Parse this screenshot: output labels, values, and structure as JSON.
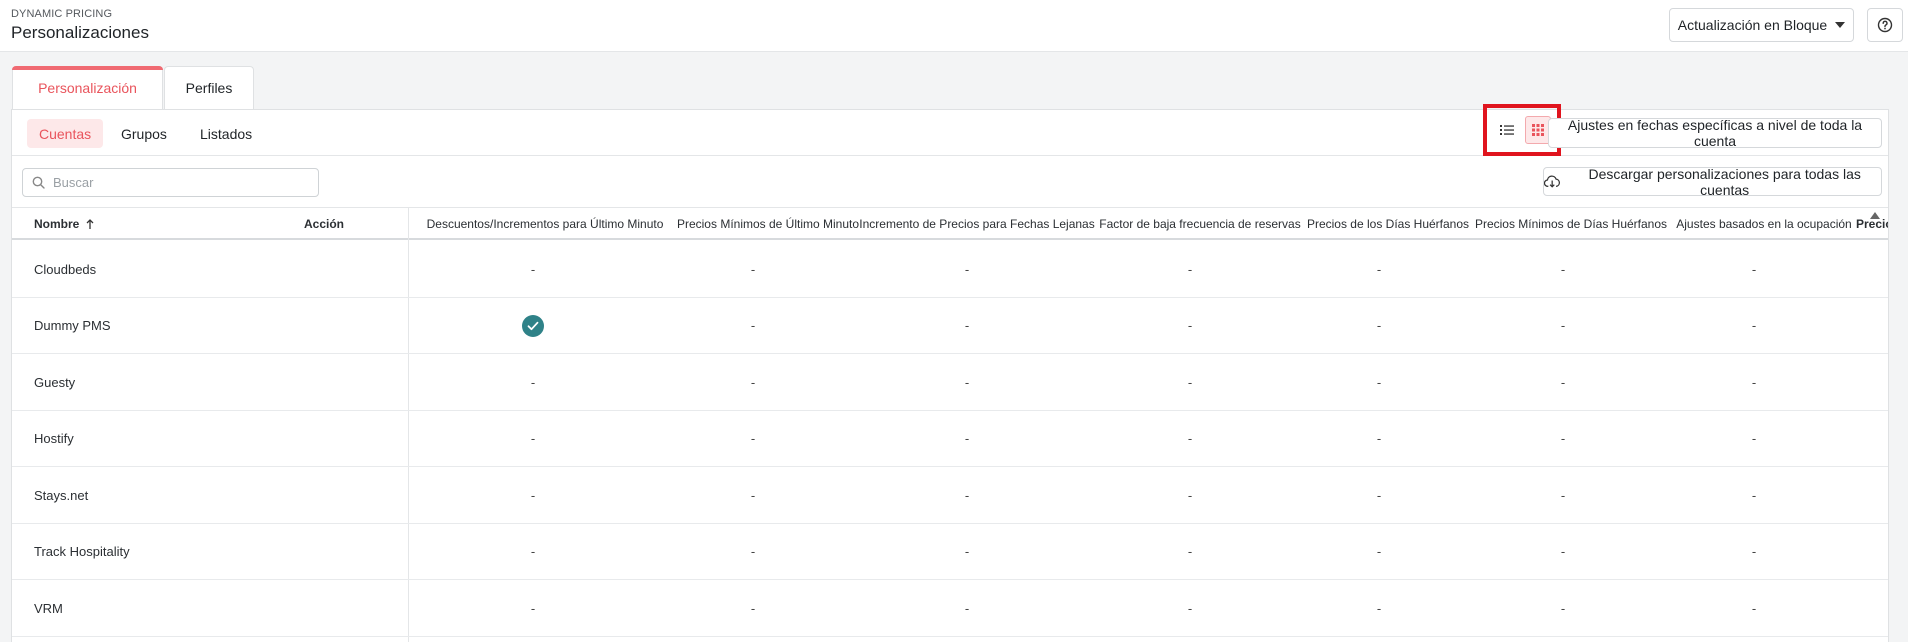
{
  "header": {
    "breadcrumb": "DYNAMIC PRICING",
    "title": "Personalizaciones",
    "bulk_update_label": "Actualización en Bloque"
  },
  "tabs": [
    {
      "label": "Personalización",
      "active": true
    },
    {
      "label": "Perfiles",
      "active": false
    }
  ],
  "subtabs": [
    {
      "label": "Cuentas",
      "active": true
    },
    {
      "label": "Grupos",
      "active": false
    },
    {
      "label": "Listados",
      "active": false
    }
  ],
  "toolbar": {
    "adjust_label": "Ajustes en fechas específicas a nivel de toda la cuenta",
    "download_label": "Descargar personalizaciones para todas las cuentas",
    "search_placeholder": "Buscar"
  },
  "table": {
    "name_header": "Nombre",
    "action_header": "Acción",
    "columns": [
      "Descuentos/Incrementos para Último Minuto",
      "Precios Mínimos de Último Minuto",
      "Incremento de Precios para Fechas Lejanas",
      "Factor de baja frecuencia de reservas",
      "Precios de los Días Huérfanos",
      "Precios Mínimos de Días Huérfanos",
      "Ajustes basados en la ocupación",
      "Precio"
    ],
    "rows": [
      {
        "name": "Cloudbeds",
        "values": [
          "-",
          "-",
          "-",
          "-",
          "-",
          "-",
          "-"
        ]
      },
      {
        "name": "Dummy PMS",
        "values": [
          "check",
          "-",
          "-",
          "-",
          "-",
          "-",
          "-"
        ]
      },
      {
        "name": "Guesty",
        "values": [
          "-",
          "-",
          "-",
          "-",
          "-",
          "-",
          "-"
        ]
      },
      {
        "name": "Hostify",
        "values": [
          "-",
          "-",
          "-",
          "-",
          "-",
          "-",
          "-"
        ]
      },
      {
        "name": "Stays.net",
        "values": [
          "-",
          "-",
          "-",
          "-",
          "-",
          "-",
          "-"
        ]
      },
      {
        "name": "Track Hospitality",
        "values": [
          "-",
          "-",
          "-",
          "-",
          "-",
          "-",
          "-"
        ]
      },
      {
        "name": "VRM",
        "values": [
          "-",
          "-",
          "-",
          "-",
          "-",
          "-",
          "-"
        ]
      }
    ]
  },
  "colors": {
    "accent": "#e9545c",
    "check": "#2f8288",
    "highlight": "#e0141e"
  }
}
